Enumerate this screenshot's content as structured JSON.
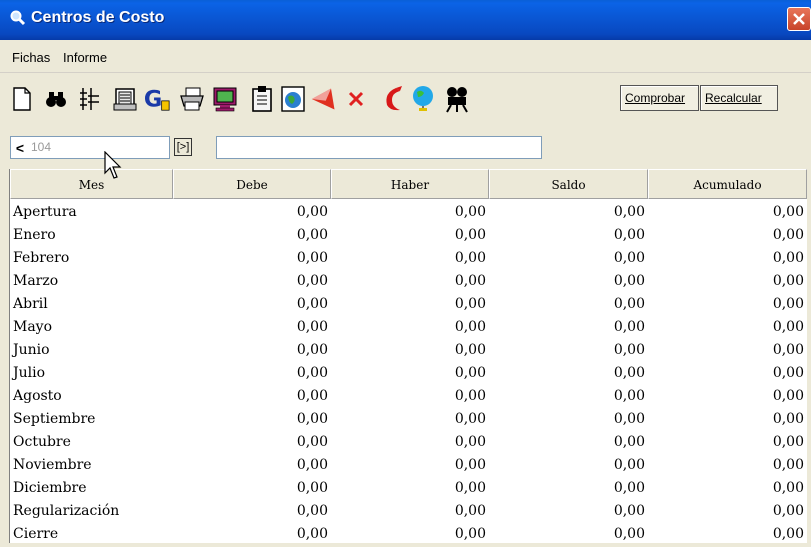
{
  "window": {
    "title": "Centros de Costo"
  },
  "menu": [
    {
      "label": "Fichas"
    },
    {
      "label": "Informe"
    }
  ],
  "toolbar": {
    "icons": [
      "new-document-icon",
      "binoculars-icon",
      "columns-icon",
      "printer-preview-icon",
      "g-chart-icon",
      "printer-icon",
      "monitor-icon",
      "clipboard-icon",
      "globe-doc-icon",
      "red-flag-icon",
      "delete-x-icon",
      "red-crescent-icon",
      "globe-stand-icon",
      "film-projector-icon"
    ],
    "comprobar_label": "Comprobar",
    "recalcular_label": "Recalcular"
  },
  "nav": {
    "prev_symbol": "<",
    "code": "104",
    "next_symbol": "[>]",
    "description": ""
  },
  "table": {
    "columns": [
      "Mes",
      "Debe",
      "Haber",
      "Saldo",
      "Acumulado"
    ],
    "rows": [
      {
        "mes": "Apertura",
        "debe": "0,00",
        "haber": "0,00",
        "saldo": "0,00",
        "acumulado": "0,00"
      },
      {
        "mes": "Enero",
        "debe": "0,00",
        "haber": "0,00",
        "saldo": "0,00",
        "acumulado": "0,00"
      },
      {
        "mes": "Febrero",
        "debe": "0,00",
        "haber": "0,00",
        "saldo": "0,00",
        "acumulado": "0,00"
      },
      {
        "mes": "Marzo",
        "debe": "0,00",
        "haber": "0,00",
        "saldo": "0,00",
        "acumulado": "0,00"
      },
      {
        "mes": "Abril",
        "debe": "0,00",
        "haber": "0,00",
        "saldo": "0,00",
        "acumulado": "0,00"
      },
      {
        "mes": "Mayo",
        "debe": "0,00",
        "haber": "0,00",
        "saldo": "0,00",
        "acumulado": "0,00"
      },
      {
        "mes": "Junio",
        "debe": "0,00",
        "haber": "0,00",
        "saldo": "0,00",
        "acumulado": "0,00"
      },
      {
        "mes": "Julio",
        "debe": "0,00",
        "haber": "0,00",
        "saldo": "0,00",
        "acumulado": "0,00"
      },
      {
        "mes": "Agosto",
        "debe": "0,00",
        "haber": "0,00",
        "saldo": "0,00",
        "acumulado": "0,00"
      },
      {
        "mes": "Septiembre",
        "debe": "0,00",
        "haber": "0,00",
        "saldo": "0,00",
        "acumulado": "0,00"
      },
      {
        "mes": "Octubre",
        "debe": "0,00",
        "haber": "0,00",
        "saldo": "0,00",
        "acumulado": "0,00"
      },
      {
        "mes": "Noviembre",
        "debe": "0,00",
        "haber": "0,00",
        "saldo": "0,00",
        "acumulado": "0,00"
      },
      {
        "mes": "Diciembre",
        "debe": "0,00",
        "haber": "0,00",
        "saldo": "0,00",
        "acumulado": "0,00"
      },
      {
        "mes": "Regularización",
        "debe": "0,00",
        "haber": "0,00",
        "saldo": "0,00",
        "acumulado": "0,00"
      },
      {
        "mes": "Cierre",
        "debe": "0,00",
        "haber": "0,00",
        "saldo": "0,00",
        "acumulado": "0,00"
      }
    ]
  }
}
